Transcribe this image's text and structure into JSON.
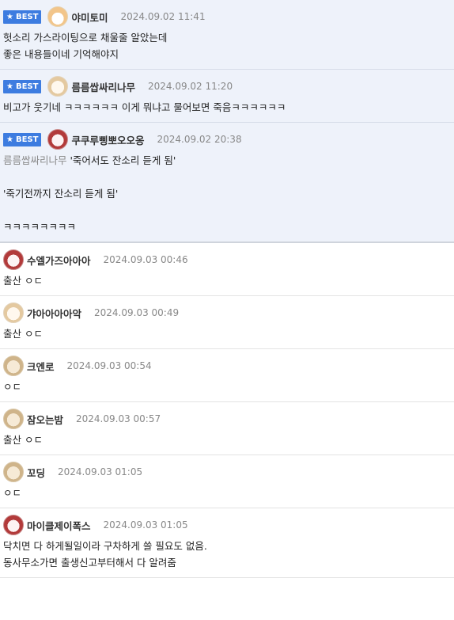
{
  "best_badge_label": "BEST",
  "comments": [
    {
      "best": true,
      "avatar": "fox-avatar",
      "nick": "야미토미",
      "time": "2024.09.02 11:41",
      "body": "헛소리 가스라이팅으로 채울줄 알았는데\n좋은 내용들이네 기억해야지"
    },
    {
      "best": true,
      "avatar": "dog-avatar",
      "nick": "름름쌉싸리나무",
      "time": "2024.09.02 11:20",
      "body": "비고가 웃기네 ㅋㅋㅋㅋㅋㅋ 이게 뭐냐고 물어보면 죽음ㅋㅋㅋㅋㅋㅋ"
    },
    {
      "best": true,
      "avatar": "red-avatar",
      "nick": "쿠쿠루삥뽀오오옹",
      "time": "2024.09.02 20:38",
      "mention": "름름쌉싸리나무",
      "body": " '죽어서도 잔소리 듣게 됨'\n\n'죽기전까지 잔소리 듣게 됨'\n\nㅋㅋㅋㅋㅋㅋㅋㅋ"
    },
    {
      "best": false,
      "avatar": "red-avatar",
      "nick": "수엘가즈아아아",
      "time": "2024.09.03 00:46",
      "body": "출산 ㅇㄷ"
    },
    {
      "best": false,
      "avatar": "dog-avatar",
      "nick": "갸아아아아악",
      "time": "2024.09.03 00:49",
      "body": "출산 ㅇㄷ"
    },
    {
      "best": false,
      "avatar": "tan-avatar",
      "nick": "크엔로",
      "time": "2024.09.03 00:54",
      "body": "ㅇㄷ"
    },
    {
      "best": false,
      "avatar": "tan-avatar",
      "nick": "잠오는밤",
      "time": "2024.09.03 00:57",
      "body": "출산 ㅇㄷ"
    },
    {
      "best": false,
      "avatar": "tan-avatar",
      "nick": "꼬딩",
      "time": "2024.09.03 01:05",
      "body": "ㅇㄷ"
    },
    {
      "best": false,
      "avatar": "red-avatar",
      "nick": "마이클제이폭스",
      "time": "2024.09.03 01:05",
      "body": "닥치면 다 하게될일이라 구차하게 쓸 필요도 없음.\n동사무소가면 출생신고부터해서 다 알려줌"
    }
  ]
}
